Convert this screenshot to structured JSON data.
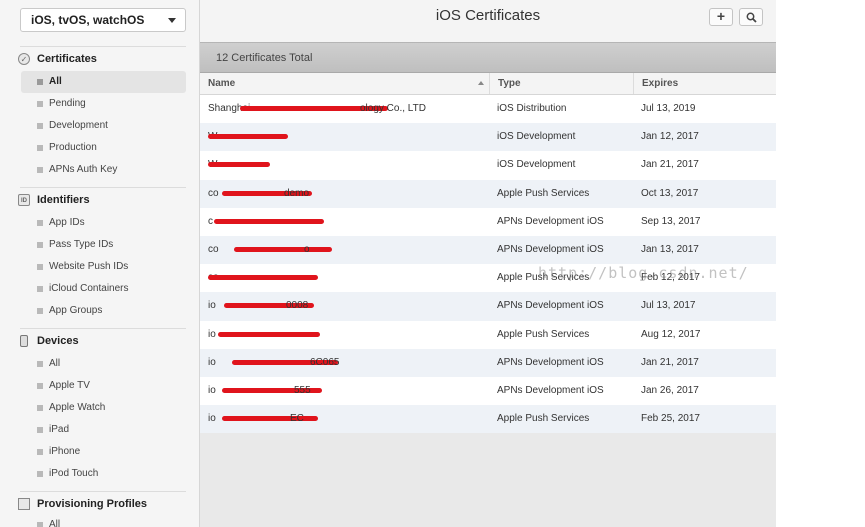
{
  "platform_select": {
    "value": "iOS, tvOS, watchOS"
  },
  "sidebar": {
    "certificates": {
      "title": "Certificates",
      "items": [
        "All",
        "Pending",
        "Development",
        "Production",
        "APNs Auth Key"
      ]
    },
    "identifiers": {
      "icon_text": "ID",
      "title": "Identifiers",
      "items": [
        "App IDs",
        "Pass Type IDs",
        "Website Push IDs",
        "iCloud Containers",
        "App Groups"
      ]
    },
    "devices": {
      "title": "Devices",
      "items": [
        "All",
        "Apple TV",
        "Apple Watch",
        "iPad",
        "iPhone",
        "iPod Touch"
      ]
    },
    "profiles": {
      "title": "Provisioning Profiles",
      "items": [
        "All"
      ]
    }
  },
  "header": {
    "title": "iOS Certificates",
    "add_icon": "+",
    "search_icon": "magnifier"
  },
  "summary": {
    "text": "12 Certificates Total"
  },
  "table": {
    "columns": [
      "Name",
      "Type",
      "Expires"
    ],
    "rows": [
      {
        "name": "Shanghai",
        "name_tail": "ology Co., LTD",
        "type": "iOS Distribution",
        "expires": "Jul 13, 2019"
      },
      {
        "name": "W",
        "name_tail": "",
        "type": "iOS Development",
        "expires": "Jan 12, 2017"
      },
      {
        "name": "W",
        "name_tail": "",
        "type": "iOS Development",
        "expires": "Jan 21, 2017"
      },
      {
        "name": "co",
        "name_tail": "demo",
        "type": "Apple Push Services",
        "expires": "Oct 13, 2017"
      },
      {
        "name": "c",
        "name_tail": "",
        "type": "APNs Development iOS",
        "expires": "Sep 13, 2017"
      },
      {
        "name": "co",
        "name_tail": "o",
        "type": "APNs Development iOS",
        "expires": "Jan 13, 2017"
      },
      {
        "name": "co",
        "name_tail": "",
        "type": "Apple Push Services",
        "expires": "Feb 12, 2017"
      },
      {
        "name": "io",
        "name_tail": "0008",
        "type": "APNs Development iOS",
        "expires": "Jul 13, 2017"
      },
      {
        "name": "io",
        "name_tail": "",
        "type": "Apple Push Services",
        "expires": "Aug 12, 2017"
      },
      {
        "name": "io",
        "name_tail": "6C065",
        "type": "APNs Development iOS",
        "expires": "Jan 21, 2017"
      },
      {
        "name": "io",
        "name_tail": "555",
        "type": "APNs Development iOS",
        "expires": "Jan 26, 2017"
      },
      {
        "name": "io",
        "name_tail": "EC",
        "type": "Apple Push Services",
        "expires": "Feb 25, 2017"
      }
    ]
  },
  "watermark": "http://blog.csdn.net/",
  "colors": {
    "redaction": "#e0141c",
    "row_alt": "#eef2f7",
    "summary_bar": "#c6c6c6"
  }
}
